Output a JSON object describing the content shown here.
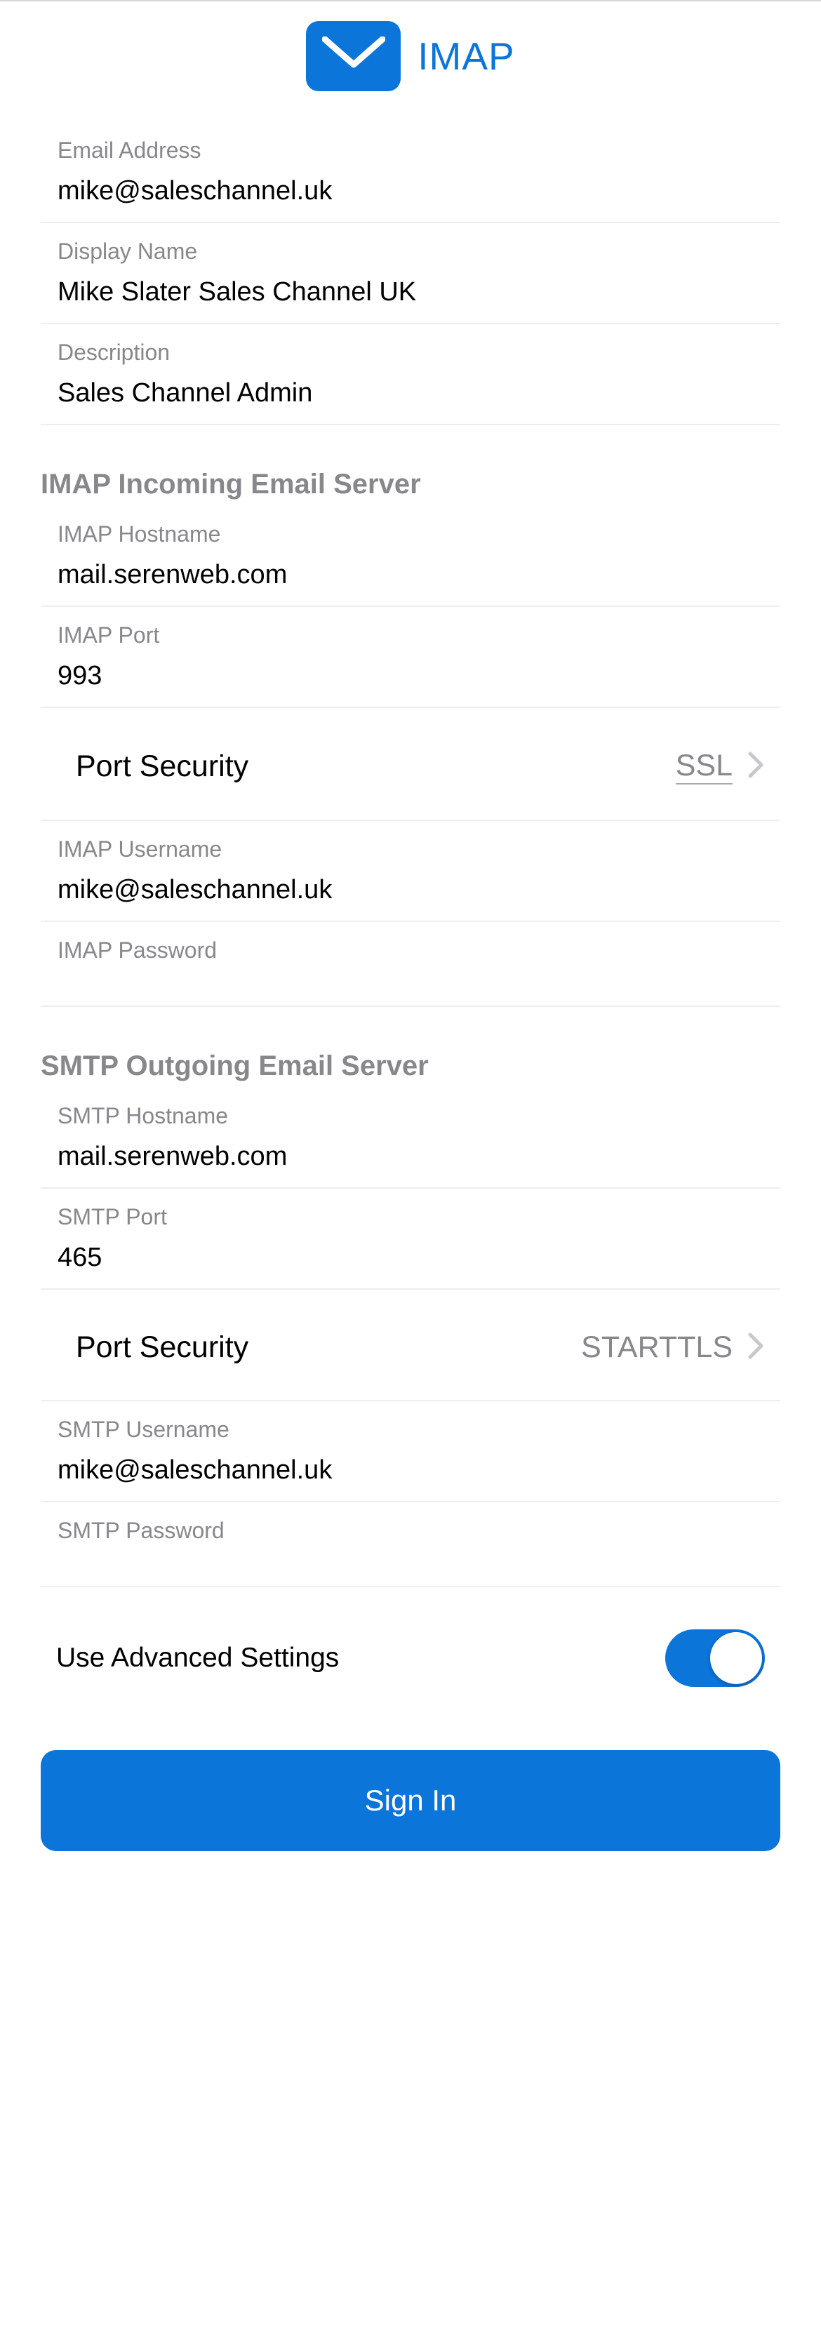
{
  "header": {
    "title": "IMAP"
  },
  "account": {
    "email_label": "Email Address",
    "email_value": "mike@saleschannel.uk",
    "display_name_label": "Display Name",
    "display_name_value": "Mike Slater Sales Channel UK",
    "description_label": "Description",
    "description_value": "Sales Channel Admin"
  },
  "imap": {
    "section_title": "IMAP Incoming Email Server",
    "hostname_label": "IMAP Hostname",
    "hostname_value": "mail.serenweb.com",
    "port_label": "IMAP Port",
    "port_value": "993",
    "port_security_label": "Port Security",
    "port_security_value": "SSL",
    "username_label": "IMAP Username",
    "username_value": "mike@saleschannel.uk",
    "password_label": "IMAP Password"
  },
  "smtp": {
    "section_title": "SMTP Outgoing Email Server",
    "hostname_label": "SMTP Hostname",
    "hostname_value": "mail.serenweb.com",
    "port_label": "SMTP Port",
    "port_value": "465",
    "port_security_label": "Port Security",
    "port_security_value": "STARTTLS",
    "username_label": "SMTP Username",
    "username_value": "mike@saleschannel.uk",
    "password_label": "SMTP Password"
  },
  "advanced": {
    "toggle_label": "Use Advanced Settings",
    "toggle_on": true
  },
  "actions": {
    "signin_label": "Sign In"
  }
}
